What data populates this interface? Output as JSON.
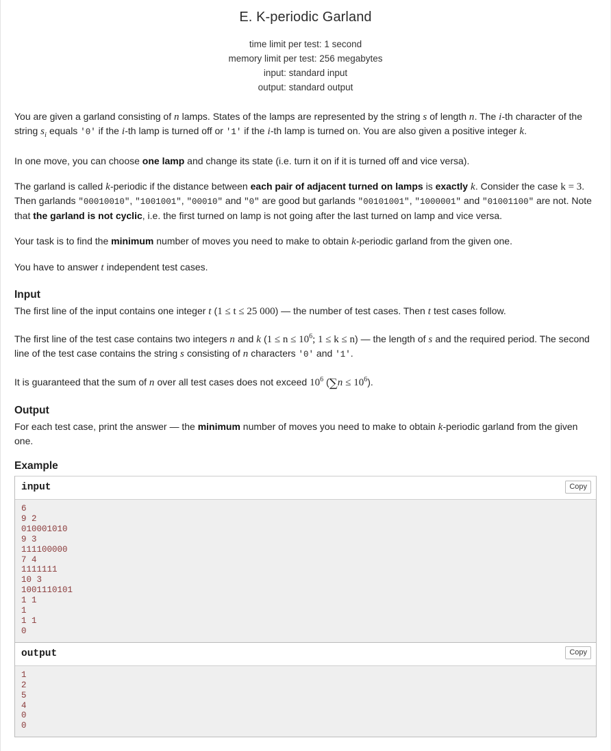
{
  "header": {
    "title": "E. K-periodic Garland",
    "time_limit": "time limit per test: 1 second",
    "memory_limit": "memory limit per test: 256 megabytes",
    "input_spec": "input: standard input",
    "output_spec": "output: standard output"
  },
  "statement": {
    "p1_a": "You are given a garland consisting of ",
    "p1_n1": "n",
    "p1_b": " lamps. States of the lamps are represented by the string ",
    "p1_s1": "s",
    "p1_c": " of length ",
    "p1_n2": "n",
    "p1_d": ". The ",
    "p1_i1": "i",
    "p1_e": "-th character of the string ",
    "p1_si": "s",
    "p1_si_sub": "i",
    "p1_f": " equals ",
    "p1_zero": "'0'",
    "p1_g": " if the ",
    "p1_i2": "i",
    "p1_h": "-th lamp is turned off or ",
    "p1_one": "'1'",
    "p1_j": " if the ",
    "p1_i3": "i",
    "p1_k": "-th lamp is turned on. You are also given a positive integer ",
    "p1_kvar": "k",
    "p1_l": ".",
    "p2_a": "In one move, you can choose ",
    "p2_bold": "one lamp",
    "p2_b": " and change its state (i.e. turn it on if it is turned off and vice versa).",
    "p3_a": "The garland is called ",
    "p3_k1": "k",
    "p3_b": "-periodic if the distance between ",
    "p3_bold1": "each pair of adjacent turned on lamps",
    "p3_c": " is ",
    "p3_bold2": "exactly",
    "p3_d": " ",
    "p3_k2": "k",
    "p3_e": ". Consider the case ",
    "p3_keq": "k = 3",
    "p3_f": ". Then garlands ",
    "p3_good1": "\"00010010\"",
    "p3_g": ", ",
    "p3_good2": "\"1001001\"",
    "p3_h": ", ",
    "p3_good3": "\"00010\"",
    "p3_i": " and ",
    "p3_good4": "\"0\"",
    "p3_j": " are good but garlands ",
    "p3_bad1": "\"00101001\"",
    "p3_k": ", ",
    "p3_bad2": "\"1000001\"",
    "p3_l": " and ",
    "p3_bad3": "\"01001100\"",
    "p3_m": " are not. Note that ",
    "p3_bold3": "the garland is not cyclic",
    "p3_n": ", i.e. the first turned on lamp is not going after the last turned on lamp and vice versa.",
    "p4_a": "Your task is to find the ",
    "p4_bold": "minimum",
    "p4_b": " number of moves you need to make to obtain ",
    "p4_k": "k",
    "p4_c": "-periodic garland from the given one.",
    "p5_a": "You have to answer ",
    "p5_t": "t",
    "p5_b": " independent test cases."
  },
  "input_section": {
    "heading": "Input",
    "p1_a": "The first line of the input contains one integer ",
    "p1_t": "t",
    "p1_b": " (",
    "p1_range": "1 ≤ t ≤ 25 000",
    "p1_c": ") — the number of test cases. Then ",
    "p1_t2": "t",
    "p1_d": " test cases follow.",
    "p2_a": "The first line of the test case contains two integers ",
    "p2_n": "n",
    "p2_b": " and ",
    "p2_k": "k",
    "p2_c": " (",
    "p2_range_n": "1 ≤ n ≤ 10",
    "p2_range_n_exp": "6",
    "p2_semi": "; ",
    "p2_range_k": "1 ≤ k ≤ n",
    "p2_d": ") — the length of ",
    "p2_s": "s",
    "p2_e": " and the required period. The second line of the test case contains the string ",
    "p2_s2": "s",
    "p2_f": " consisting of ",
    "p2_n2": "n",
    "p2_g": " characters ",
    "p2_zero": "'0'",
    "p2_h": " and ",
    "p2_one": "'1'",
    "p2_i": ".",
    "p3_a": "It is guaranteed that the sum of ",
    "p3_n": "n",
    "p3_b": " over all test cases does not exceed ",
    "p3_limit": "10",
    "p3_limit_exp": "6",
    "p3_c": " (",
    "p3_sum": "∑",
    "p3_sum_n": "n",
    "p3_le": " ≤ 10",
    "p3_le_exp": "6",
    "p3_d": ")."
  },
  "output_section": {
    "heading": "Output",
    "p1_a": "For each test case, print the answer — the ",
    "p1_bold": "minimum",
    "p1_b": " number of moves you need to make to obtain ",
    "p1_k": "k",
    "p1_c": "-periodic garland from the given one."
  },
  "example": {
    "heading": "Example",
    "input_label": "input",
    "output_label": "output",
    "copy_label": "Copy",
    "input_text": "6\n9 2\n010001010\n9 3\n111100000\n7 4\n1111111\n10 3\n1001110101\n1 1\n1\n1 1\n0",
    "output_text": "1\n2\n5\n4\n0\n0"
  },
  "colors": {
    "sample_text": "#8a3b3b",
    "sample_bg": "#efefef",
    "border": "#bbbbbb"
  }
}
